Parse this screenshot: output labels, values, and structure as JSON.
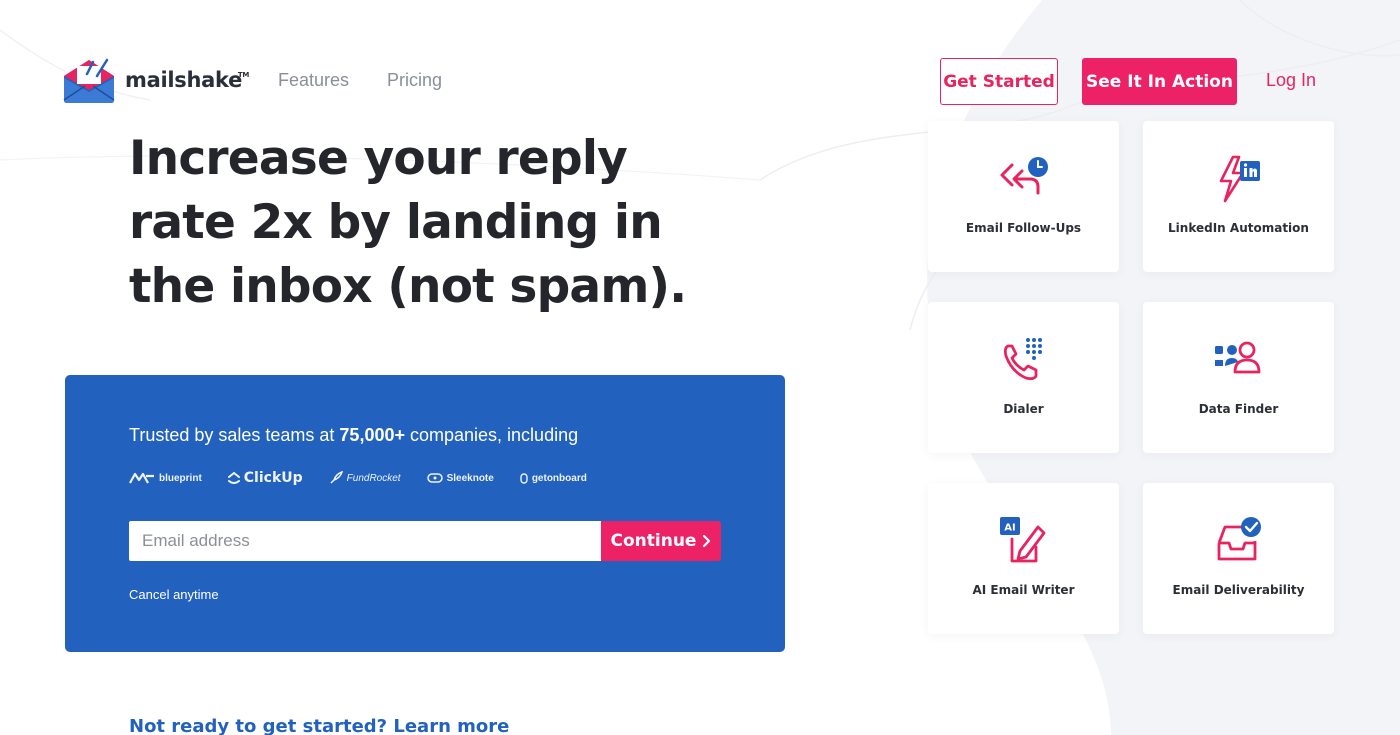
{
  "brand": {
    "name": "mailshake",
    "trademark": "TM"
  },
  "nav": {
    "features": "Features",
    "pricing": "Pricing"
  },
  "header_actions": {
    "get_started": "Get Started",
    "see_it_in_action": "See It In Action",
    "log_in": "Log In"
  },
  "hero": {
    "headline_line1": "Increase your reply",
    "headline_line2": "rate 2x by landing in",
    "headline_line3": "the inbox (not spam)."
  },
  "signup": {
    "trusted_prefix": "Trusted by sales teams at ",
    "trusted_count": "75,000+",
    "trusted_suffix": " companies, including",
    "logos": [
      "blueprint",
      "ClickUp",
      "FundRocket",
      "Sleeknote",
      "getonboard"
    ],
    "email_placeholder": "Email address",
    "continue_label": "Continue",
    "cancel_note": "Cancel anytime"
  },
  "learn_more": "Not ready to get started? Learn more",
  "features": [
    {
      "label": "Email Follow-Ups",
      "icon": "reply-clock-icon"
    },
    {
      "label": "LinkedIn Automation",
      "icon": "linkedin-bolt-icon"
    },
    {
      "label": "Dialer",
      "icon": "phone-dialpad-icon"
    },
    {
      "label": "Data Finder",
      "icon": "people-search-icon"
    },
    {
      "label": "AI Email Writer",
      "icon": "ai-pen-icon"
    },
    {
      "label": "Email Deliverability",
      "icon": "inbox-check-icon"
    }
  ],
  "colors": {
    "accent_pink": "#ed2166",
    "panel_blue": "#2262be",
    "icon_blue": "#2a62b8",
    "heading": "#25262b"
  }
}
